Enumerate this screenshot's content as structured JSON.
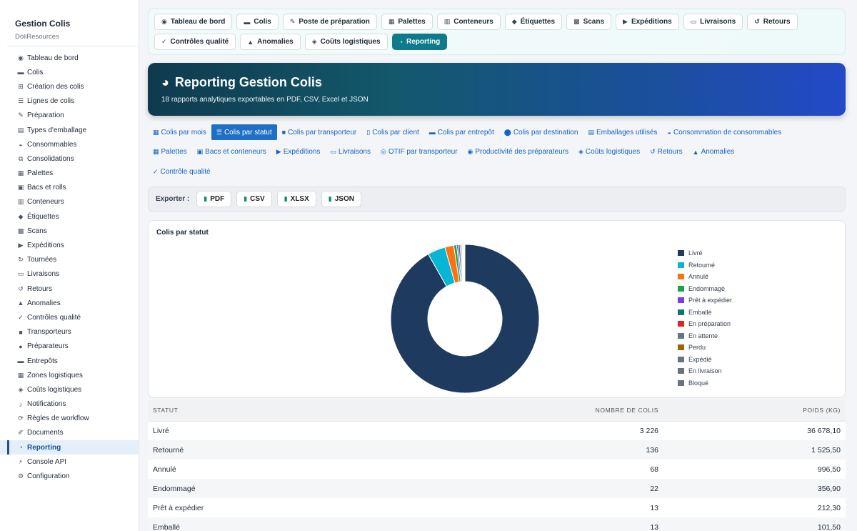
{
  "sidebar": {
    "title": "Gestion Colis",
    "subtitle": "DoliResources",
    "items": [
      {
        "label": "Tableau de bord",
        "icon": "◉"
      },
      {
        "label": "Colis",
        "icon": "▬"
      },
      {
        "label": "Création des colis",
        "icon": "⊞"
      },
      {
        "label": "Lignes de colis",
        "icon": "☰"
      },
      {
        "label": "Préparation",
        "icon": "✎"
      },
      {
        "label": "Types d'emballage",
        "icon": "▤"
      },
      {
        "label": "Consommables",
        "icon": "◒"
      },
      {
        "label": "Consolidations",
        "icon": "⧉"
      },
      {
        "label": "Palettes",
        "icon": "▦"
      },
      {
        "label": "Bacs et rolls",
        "icon": "▣"
      },
      {
        "label": "Conteneurs",
        "icon": "▥"
      },
      {
        "label": "Étiquettes",
        "icon": "◆"
      },
      {
        "label": "Scans",
        "icon": "▩"
      },
      {
        "label": "Expéditions",
        "icon": "▶"
      },
      {
        "label": "Tournées",
        "icon": "↻"
      },
      {
        "label": "Livraisons",
        "icon": "▭"
      },
      {
        "label": "Retours",
        "icon": "↺"
      },
      {
        "label": "Anomalies",
        "icon": "▲"
      },
      {
        "label": "Contrôles qualité",
        "icon": "✓"
      },
      {
        "label": "Transporteurs",
        "icon": "■"
      },
      {
        "label": "Préparateurs",
        "icon": "●"
      },
      {
        "label": "Entrepôts",
        "icon": "▬"
      },
      {
        "label": "Zones logistiques",
        "icon": "▦"
      },
      {
        "label": "Coûts logistiques",
        "icon": "◈"
      },
      {
        "label": "Notifications",
        "icon": "♪"
      },
      {
        "label": "Règles de workflow",
        "icon": "⟳"
      },
      {
        "label": "Documents",
        "icon": "✐"
      },
      {
        "label": "Reporting",
        "icon": "◔",
        "active": true
      },
      {
        "label": "Console API",
        "icon": "⚡"
      },
      {
        "label": "Configuration",
        "icon": "⚙"
      }
    ]
  },
  "topnav": {
    "row1": [
      {
        "label": "Tableau de bord",
        "icon": "◉"
      },
      {
        "label": "Colis",
        "icon": "▬"
      },
      {
        "label": "Poste de préparation",
        "icon": "✎"
      },
      {
        "label": "Palettes",
        "icon": "▦"
      },
      {
        "label": "Conteneurs",
        "icon": "▥"
      },
      {
        "label": "Étiquettes",
        "icon": "◆"
      },
      {
        "label": "Scans",
        "icon": "▩"
      },
      {
        "label": "Expéditions",
        "icon": "▶"
      },
      {
        "label": "Livraisons",
        "icon": "▭"
      },
      {
        "label": "Retours",
        "icon": "↺"
      }
    ],
    "row2": [
      {
        "label": "Contrôles qualité",
        "icon": "✓"
      },
      {
        "label": "Anomalies",
        "icon": "▲"
      },
      {
        "label": "Coûts logistiques",
        "icon": "◈"
      },
      {
        "label": "Reporting",
        "icon": "◔",
        "active": true
      }
    ]
  },
  "hero": {
    "title": "Reporting Gestion Colis",
    "subtitle": "18 rapports analytiques exportables en PDF, CSV, Excel et JSON",
    "icon": "◕"
  },
  "report_tabs": {
    "row1": [
      {
        "label": "Colis par mois",
        "icon": "▦"
      },
      {
        "label": "Colis par statut",
        "icon": "☰",
        "active": true
      },
      {
        "label": "Colis par transporteur",
        "icon": "■"
      },
      {
        "label": "Colis par client",
        "icon": "▯"
      },
      {
        "label": "Colis par entrepôt",
        "icon": "▬"
      },
      {
        "label": "Colis par destination",
        "icon": "⬤"
      },
      {
        "label": "Emballages utilisés",
        "icon": "▤"
      },
      {
        "label": "Consommation de consommables",
        "icon": "◒"
      }
    ],
    "row2": [
      {
        "label": "Palettes",
        "icon": "▦"
      },
      {
        "label": "Bacs et conteneurs",
        "icon": "▣"
      },
      {
        "label": "Expéditions",
        "icon": "▶"
      },
      {
        "label": "Livraisons",
        "icon": "▭"
      },
      {
        "label": "OTIF par transporteur",
        "icon": "◎"
      },
      {
        "label": "Productivité des préparateurs",
        "icon": "◉"
      },
      {
        "label": "Coûts logistiques",
        "icon": "◈"
      },
      {
        "label": "Retours",
        "icon": "↺"
      },
      {
        "label": "Anomalies",
        "icon": "▲"
      }
    ],
    "row3": [
      {
        "label": "Contrôle qualité",
        "icon": "✓"
      }
    ]
  },
  "export": {
    "label": "Exporter :",
    "buttons": [
      {
        "label": "PDF",
        "icon": "▮"
      },
      {
        "label": "CSV",
        "icon": "▮"
      },
      {
        "label": "XLSX",
        "icon": "▮"
      },
      {
        "label": "JSON",
        "icon": "▮"
      }
    ]
  },
  "chart_data": {
    "type": "pie",
    "title": "Colis par statut",
    "categories": [
      "Livré",
      "Retourné",
      "Annulé",
      "Endommagé",
      "Prêt à expédier",
      "Emballé",
      "En préparation",
      "En attente",
      "Perdu",
      "Expédié",
      "En livraison",
      "Bloqué"
    ],
    "values": [
      3226,
      136,
      68,
      22,
      13,
      13,
      9,
      7,
      6,
      6,
      5,
      4
    ],
    "colors": [
      "#1e3a5f",
      "#06b6d4",
      "#f97316",
      "#16a34a",
      "#7c3aed",
      "#0f766e",
      "#dc2626",
      "#64748b",
      "#a16207",
      "#6b7280",
      "#6b7280",
      "#6b7280"
    ],
    "legend_position": "right",
    "donut": true
  },
  "table": {
    "headers": [
      "STATUT",
      "NOMBRE DE COLIS",
      "POIDS (KG)"
    ],
    "rows": [
      [
        "Livré",
        "3 226",
        "36 678,10"
      ],
      [
        "Retourné",
        "136",
        "1 525,50"
      ],
      [
        "Annulé",
        "68",
        "996,50"
      ],
      [
        "Endommagé",
        "22",
        "356,90"
      ],
      [
        "Prêt à expédier",
        "13",
        "212,30"
      ],
      [
        "Emballé",
        "13",
        "101,50"
      ]
    ]
  }
}
